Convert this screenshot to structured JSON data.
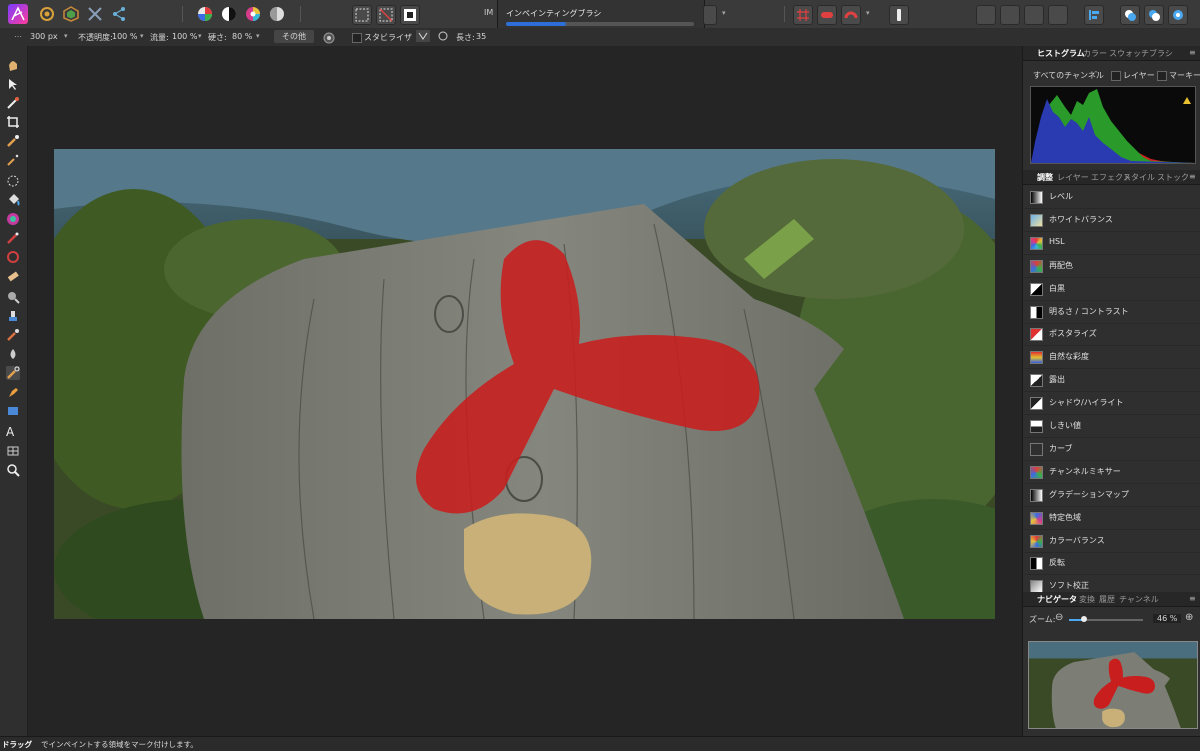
{
  "progress_title": "インペインティングブラシ",
  "progress_fraction": 0.32,
  "context_bar": {
    "width_value": "300 px",
    "opacity_label": "不透明度:",
    "opacity_value": "100 %",
    "flow_label": "流量:",
    "flow_value": "100 %",
    "hardness_label": "硬さ:",
    "hardness_value": "80 %",
    "more_button": "その他",
    "stabilizer_label": "スタビライザ",
    "length_label": "長さ:",
    "length_value": "35"
  },
  "histogram_panel": {
    "tabs": [
      "ヒストグラム",
      "カラー",
      "スウォッチ",
      "ブラシ"
    ],
    "channel_select": "すべてのチャンネル",
    "layer_checkbox": "レイヤー",
    "marquee_checkbox": "マーキー"
  },
  "adjustments_panel": {
    "tabs": [
      "調整",
      "レイヤー",
      "エフェクト",
      "スタイル",
      "ストック"
    ],
    "items": [
      {
        "label": "レベル",
        "icon": "levels-icon"
      },
      {
        "label": "ホワイトバランス",
        "icon": "white-balance-icon"
      },
      {
        "label": "HSL",
        "icon": "hsl-icon"
      },
      {
        "label": "再配色",
        "icon": "recolor-icon"
      },
      {
        "label": "白黒",
        "icon": "black-white-icon"
      },
      {
        "label": "明るさ / コントラスト",
        "icon": "brightness-contrast-icon"
      },
      {
        "label": "ポスタライズ",
        "icon": "posterize-icon"
      },
      {
        "label": "自然な彩度",
        "icon": "vibrance-icon"
      },
      {
        "label": "露出",
        "icon": "exposure-icon"
      },
      {
        "label": "シャドウ/ハイライト",
        "icon": "shadows-highlights-icon"
      },
      {
        "label": "しきい値",
        "icon": "threshold-icon"
      },
      {
        "label": "カーブ",
        "icon": "curves-icon"
      },
      {
        "label": "チャンネルミキサー",
        "icon": "channel-mixer-icon"
      },
      {
        "label": "グラデーションマップ",
        "icon": "gradient-map-icon"
      },
      {
        "label": "特定色域",
        "icon": "selective-color-icon"
      },
      {
        "label": "カラーバランス",
        "icon": "color-balance-icon"
      },
      {
        "label": "反転",
        "icon": "invert-icon"
      },
      {
        "label": "ソフト校正",
        "icon": "soft-proof-icon"
      }
    ]
  },
  "navigator_panel": {
    "tabs": [
      "ナビゲータ",
      "変換",
      "履歴",
      "チャンネル"
    ],
    "zoom_label": "ズーム:",
    "zoom_value": "46 %"
  },
  "status_bar": {
    "bold": "ドラッグ",
    "rest": "でインペイントする領域をマーク付けします。"
  },
  "colors": {
    "accent": "#2d6fd6",
    "brush_mask": "#c81e1e",
    "panel_bg": "#2f2f2f"
  }
}
